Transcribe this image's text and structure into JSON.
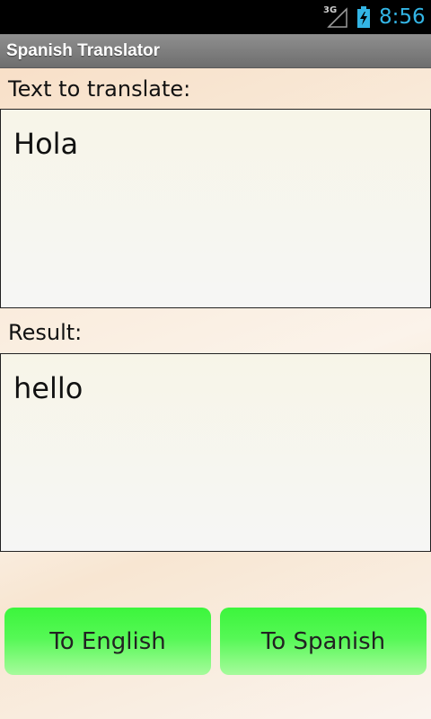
{
  "status_bar": {
    "network": "3G",
    "time": "8:56",
    "icons": [
      "signal-icon",
      "battery-charging-icon"
    ]
  },
  "app": {
    "title": "Spanish Translator"
  },
  "input": {
    "label": "Text to translate:",
    "value": "Hola"
  },
  "result": {
    "label": "Result:",
    "value": "hello"
  },
  "buttons": {
    "to_english": "To English",
    "to_spanish": "To Spanish"
  },
  "colors": {
    "status_time": "#33b5e5",
    "button_green": "#3cf53c",
    "action_bar": "#7d7d7d"
  }
}
